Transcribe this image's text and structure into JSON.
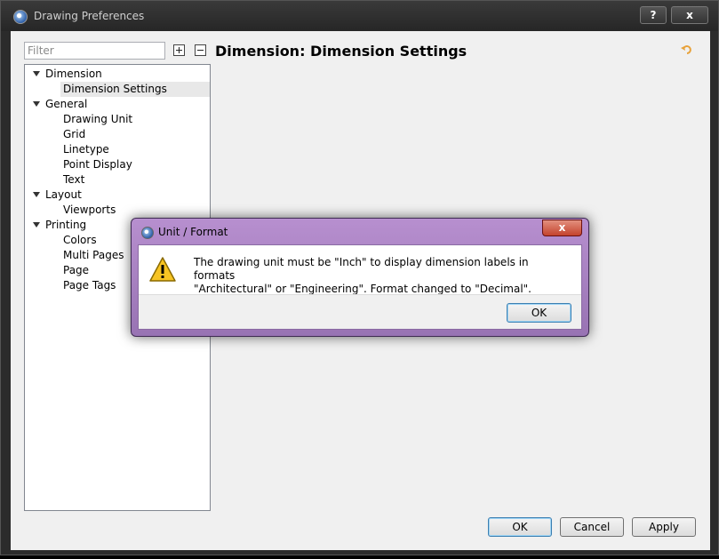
{
  "window": {
    "title": "Drawing Preferences",
    "help_label": "?",
    "close_label": "x"
  },
  "filter": {
    "placeholder": "Filter"
  },
  "tree": {
    "items": [
      {
        "label": "Dimension",
        "level": 0,
        "expanded": true
      },
      {
        "label": "Dimension Settings",
        "level": 1,
        "selected": true
      },
      {
        "label": "General",
        "level": 0,
        "expanded": true
      },
      {
        "label": "Drawing Unit",
        "level": 1
      },
      {
        "label": "Grid",
        "level": 1
      },
      {
        "label": "Linetype",
        "level": 1
      },
      {
        "label": "Point Display",
        "level": 1
      },
      {
        "label": "Text",
        "level": 1
      },
      {
        "label": "Layout",
        "level": 0,
        "expanded": true
      },
      {
        "label": "Viewports",
        "level": 1
      },
      {
        "label": "Printing",
        "level": 0,
        "expanded": true
      },
      {
        "label": "Colors",
        "level": 1
      },
      {
        "label": "Multi Pages",
        "level": 1
      },
      {
        "label": "Page",
        "level": 1
      },
      {
        "label": "Page Tags",
        "level": 1
      }
    ]
  },
  "page": {
    "title": "Dimension: Dimension Settings"
  },
  "buttons": {
    "ok": "OK",
    "cancel": "Cancel",
    "apply": "Apply"
  },
  "modal": {
    "title": "Unit / Format",
    "close_label": "x",
    "message_line1": "The drawing unit must be \"Inch\" to display dimension labels in formats",
    "message_line2": "\"Architectural\" or \"Engineering\". Format changed to \"Decimal\".",
    "ok": "OK"
  },
  "colors": {
    "accent": "#3c7fb1",
    "modal_frame": "#a986c4",
    "restore_icon": "#e8a23a"
  }
}
